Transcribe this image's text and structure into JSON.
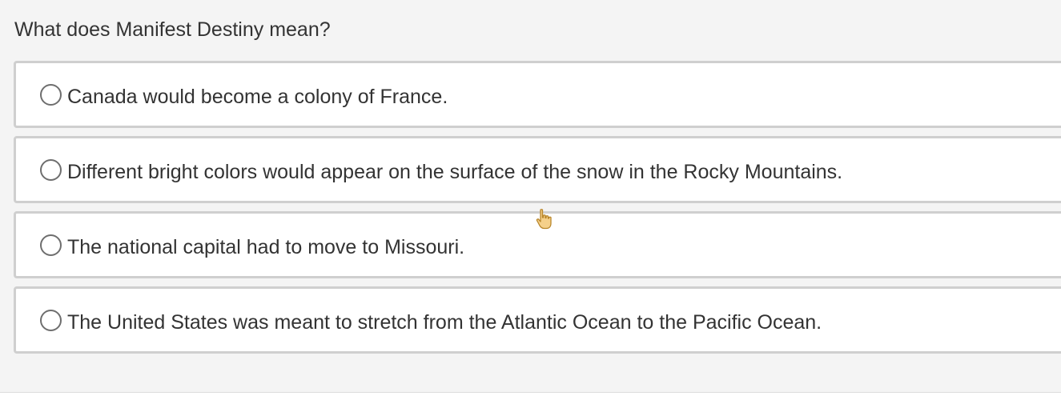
{
  "question": {
    "text": "What does Manifest Destiny mean?"
  },
  "options": [
    {
      "label": "Canada would become a colony of France.",
      "selected": false
    },
    {
      "label": "Different bright colors would appear on the surface of the snow in the Rocky Mountains.",
      "selected": false
    },
    {
      "label": "The national capital had to move to Missouri.",
      "selected": false
    },
    {
      "label": "The United States was meant to stretch from the Atlantic Ocean to the Pacific Ocean.",
      "selected": false
    }
  ],
  "cursor": {
    "icon": "hand-pointer-icon"
  },
  "colors": {
    "background": "#f4f4f4",
    "option_background": "#ffffff",
    "option_border": "#cfcfcf",
    "text": "#333333",
    "radio_border": "#6e6e6e",
    "cursor_fill": "#f5d08a",
    "cursor_stroke": "#b8862b"
  }
}
